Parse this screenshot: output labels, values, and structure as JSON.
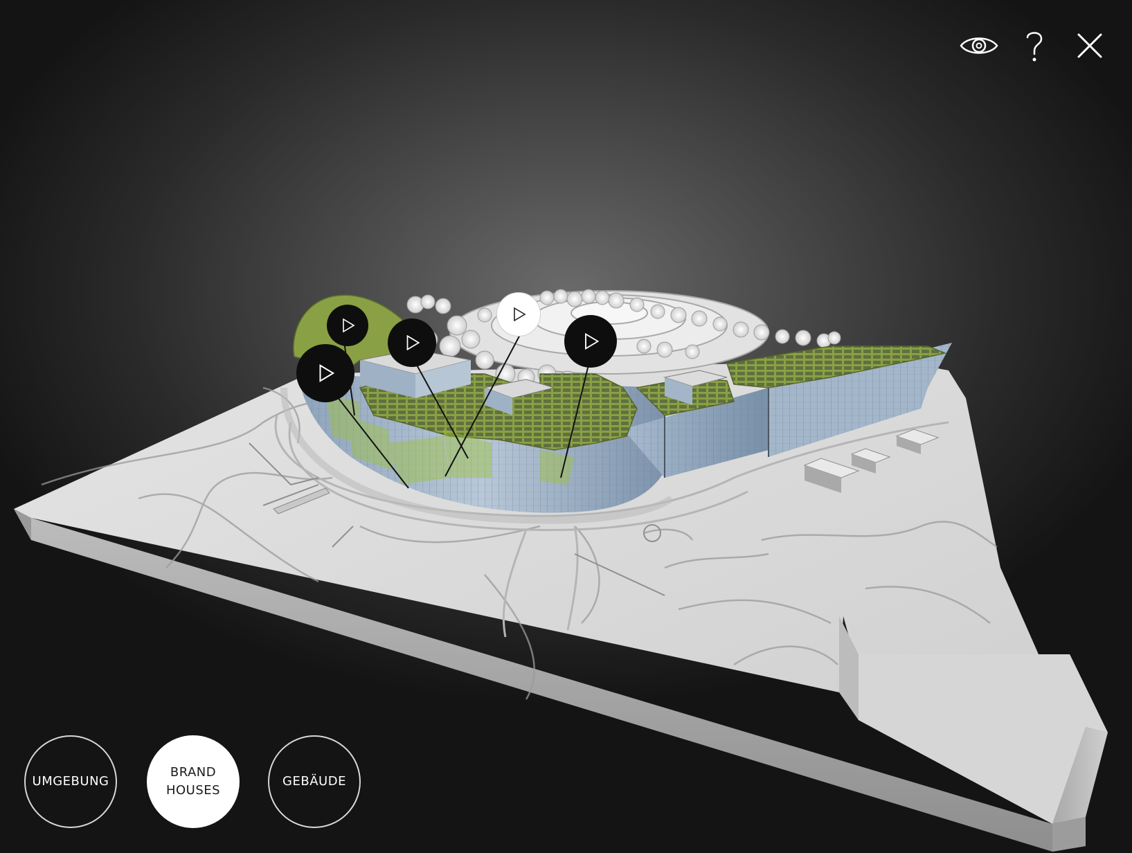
{
  "toolbar": {
    "eye_icon": "eye-icon",
    "help_icon": "question-icon",
    "close_icon": "close-icon"
  },
  "modes": [
    {
      "label": "UMGEBUNG",
      "active": false
    },
    {
      "label": "BRAND\nHOUSES",
      "active": true
    },
    {
      "label": "GEBÄUDE",
      "active": false
    }
  ],
  "hotspots": [
    {
      "icon": "play-icon",
      "style": "dark"
    },
    {
      "icon": "play-icon",
      "style": "dark"
    },
    {
      "icon": "play-icon",
      "style": "dark"
    },
    {
      "icon": "play-icon",
      "style": "light"
    },
    {
      "icon": "play-icon",
      "style": "dark"
    }
  ],
  "colors": {
    "background_dark": "#141414",
    "background_light": "#6a6a6a",
    "roof_green": "#8aa044",
    "glass_blue": "#9fb4cc",
    "terrain": "#dcdcdc"
  }
}
